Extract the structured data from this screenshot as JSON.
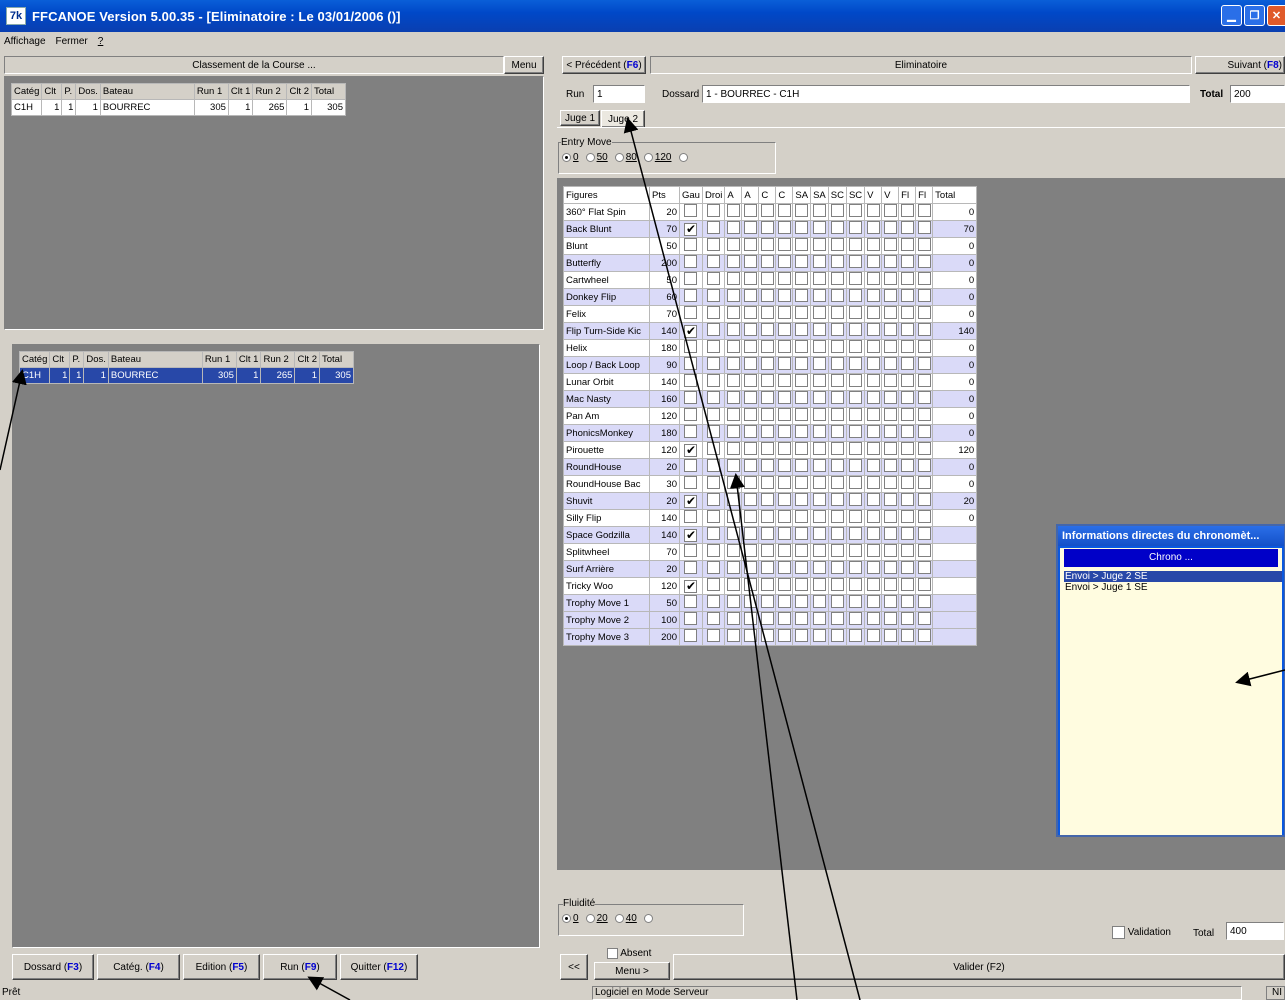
{
  "title": "FFCANOE Version 5.00.35  - [Eliminatoire :  Le 03/01/2006 ()]",
  "app_icon_text": "7k",
  "menu": [
    "Affichage",
    "Fermer",
    "?"
  ],
  "left": {
    "classement_title": "Classement de la Course ...",
    "menu_btn": "Menu",
    "table_headers": [
      "Catég",
      "Clt",
      "P.",
      "Dos.",
      "Bateau",
      "Run 1",
      "Clt 1",
      "Run 2",
      "Clt 2",
      "Total"
    ],
    "top_rows": [
      [
        "C1H",
        "1",
        "1",
        "1",
        "BOURREC",
        "305",
        "1",
        "265",
        "1",
        "305"
      ]
    ],
    "bottom_rows": [
      [
        "C1H",
        "1",
        "1",
        "1",
        "BOURREC",
        "305",
        "1",
        "265",
        "1",
        "305"
      ]
    ]
  },
  "bottom_buttons": [
    {
      "label": "Dossard (",
      "key": "F3",
      "end": ")"
    },
    {
      "label": "Catég. (",
      "key": "F4",
      "end": ")"
    },
    {
      "label": "Edition (",
      "key": "F5",
      "end": ")"
    },
    {
      "label": "Run (",
      "key": "F9",
      "end": ")"
    },
    {
      "label": "Quitter (",
      "key": "F12",
      "end": ")"
    }
  ],
  "right": {
    "prev_btn": "< Précédent (",
    "prev_key": "F6",
    "section_title": "Eliminatoire",
    "next_btn": "Suivant (",
    "next_key": "F8",
    "run_label": "Run",
    "run_value": "1",
    "dossard_label": "Dossard",
    "dossard_value": "1 - BOURREC - C1H",
    "total_label": "Total",
    "total_value": "200",
    "tabs": [
      "Juge 1",
      "Juge 2"
    ],
    "entry_move_label": "Entry Move",
    "entry_move_options": [
      "0",
      "50",
      "80",
      "120",
      ""
    ],
    "fig_headers": [
      "Figures",
      "Pts",
      "Gau",
      "Droi",
      "A",
      "A",
      "C",
      "C",
      "SA",
      "SA",
      "SC",
      "SC",
      "V",
      "V",
      "Fl",
      "Fl",
      "Total"
    ],
    "figures": [
      {
        "name": "360° Flat Spin",
        "pts": "20",
        "gau": false,
        "total": "0"
      },
      {
        "name": "Back Blunt",
        "pts": "70",
        "gau": true,
        "total": "70"
      },
      {
        "name": "Blunt",
        "pts": "50",
        "gau": false,
        "total": "0"
      },
      {
        "name": "Butterfly",
        "pts": "200",
        "gau": false,
        "total": "0"
      },
      {
        "name": "Cartwheel",
        "pts": "50",
        "gau": false,
        "total": "0"
      },
      {
        "name": "Donkey Flip",
        "pts": "60",
        "gau": false,
        "total": "0"
      },
      {
        "name": "Felix",
        "pts": "70",
        "gau": false,
        "total": "0"
      },
      {
        "name": "Flip Turn-Side Kic",
        "pts": "140",
        "gau": true,
        "total": "140"
      },
      {
        "name": "Helix",
        "pts": "180",
        "gau": false,
        "total": "0"
      },
      {
        "name": "Loop / Back Loop",
        "pts": "90",
        "gau": false,
        "total": "0"
      },
      {
        "name": "Lunar Orbit",
        "pts": "140",
        "gau": false,
        "total": "0"
      },
      {
        "name": "Mac Nasty",
        "pts": "160",
        "gau": false,
        "total": "0"
      },
      {
        "name": "Pan Am",
        "pts": "120",
        "gau": false,
        "total": "0"
      },
      {
        "name": "PhonicsMonkey",
        "pts": "180",
        "gau": false,
        "total": "0"
      },
      {
        "name": "Pirouette",
        "pts": "120",
        "gau": true,
        "total": "120"
      },
      {
        "name": "RoundHouse",
        "pts": "20",
        "gau": false,
        "total": "0"
      },
      {
        "name": "RoundHouse Bac",
        "pts": "30",
        "gau": false,
        "total": "0"
      },
      {
        "name": "Shuvit",
        "pts": "20",
        "gau": true,
        "total": "20"
      },
      {
        "name": "Silly Flip",
        "pts": "140",
        "gau": false,
        "total": "0"
      },
      {
        "name": "Space Godzilla",
        "pts": "140",
        "gau": true,
        "total": ""
      },
      {
        "name": "Splitwheel",
        "pts": "70",
        "gau": false,
        "total": ""
      },
      {
        "name": "Surf Arrière",
        "pts": "20",
        "gau": false,
        "total": ""
      },
      {
        "name": "Tricky Woo",
        "pts": "120",
        "gau": true,
        "total": ""
      },
      {
        "name": "Trophy Move 1",
        "pts": "50",
        "gau": false,
        "total": ""
      },
      {
        "name": "Trophy Move 2",
        "pts": "100",
        "gau": false,
        "total": ""
      },
      {
        "name": "Trophy Move 3",
        "pts": "200",
        "gau": false,
        "total": ""
      }
    ],
    "fluidite_label": "Fluidité",
    "fluidite_options": [
      "0",
      "20",
      "40",
      ""
    ],
    "validation_label": "Validation",
    "total2_label": "Total",
    "total2_value": "400",
    "back_btn": "<<",
    "absent_label": "Absent",
    "menu_btn": "Menu >",
    "valider_label": "Valider (F2)"
  },
  "popup": {
    "title": "Informations directes du chronomèt...",
    "header": "Chrono ...",
    "items": [
      "Envoi > Juge 2 SE",
      "Envoi > Juge 1 SE"
    ]
  },
  "status": {
    "left": "Prêt",
    "middle": "Logiciel en Mode Serveur",
    "right": "NI"
  },
  "colors": {
    "titlebar": "#0048c8",
    "selection": "#2848a8",
    "row_alt": "#dadaf8",
    "key_blue": "#0000d0"
  }
}
